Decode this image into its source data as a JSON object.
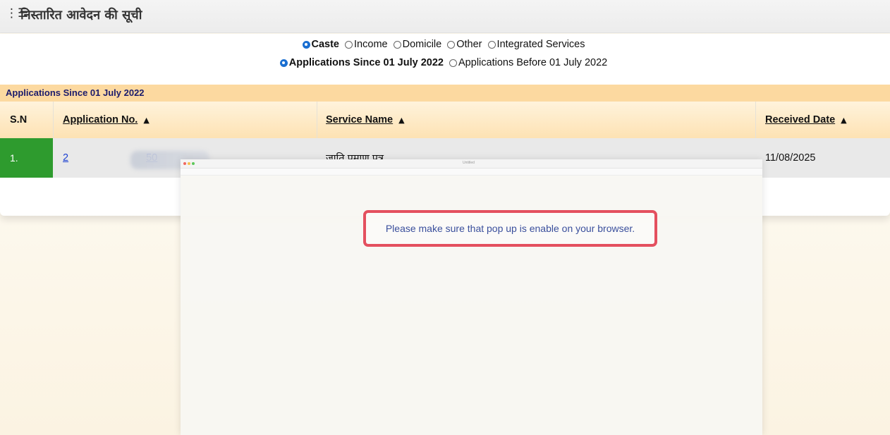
{
  "page_title": "निस्तारित आवेदन की सूची",
  "category_options": [
    {
      "label": "Caste",
      "selected": true
    },
    {
      "label": "Income",
      "selected": false
    },
    {
      "label": "Domicile",
      "selected": false
    },
    {
      "label": "Other",
      "selected": false
    },
    {
      "label": "Integrated Services",
      "selected": false
    }
  ],
  "period_options": [
    {
      "label": "Applications Since 01 July 2022",
      "selected": true
    },
    {
      "label": "Applications Before 01 July 2022",
      "selected": false
    }
  ],
  "section_title": "Applications Since 01 July 2022",
  "table": {
    "headers": [
      "S.N",
      "Application No.",
      "Service Name",
      "Received Date"
    ],
    "rows": [
      {
        "sn": "1.",
        "application_no_start": "2",
        "application_no_end": "50",
        "service_name": "जाति प्रमाण पत्र",
        "received_date": "11/08/2025"
      }
    ]
  },
  "popup": {
    "window_title": "Untitled",
    "message": "Please make sure that pop up is enable on your browser."
  },
  "colors": {
    "sn_cell": "#2e9b2e",
    "header_band": "#fcd9a0",
    "highlight_border": "#e4505f",
    "link": "#1a3fd1"
  }
}
